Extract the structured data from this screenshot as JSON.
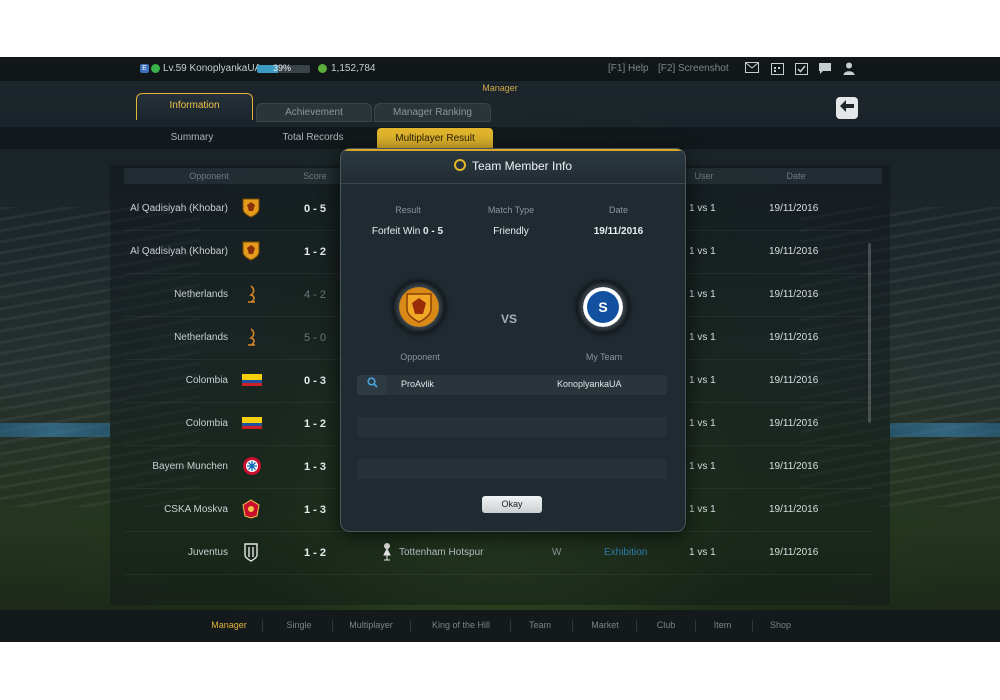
{
  "topbar": {
    "level": "Lv.59",
    "username": "KonoplyankaUA",
    "xp_percent": "39%",
    "xp_fraction": 0.39,
    "coins": "1,152,784",
    "help": "[F1] Help",
    "screenshot": "[F2] Screenshot",
    "badge_letter": "E"
  },
  "section": "Manager",
  "tabs": [
    {
      "label": "Information"
    },
    {
      "label": "Achievement"
    },
    {
      "label": "Manager Ranking"
    }
  ],
  "subtabs": [
    {
      "label": "Summary"
    },
    {
      "label": "Total Records"
    },
    {
      "label": "Multiplayer Result"
    }
  ],
  "table": {
    "headers": {
      "opponent": "Opponent",
      "score": "Score",
      "user": "User",
      "date": "Date"
    },
    "rows": [
      {
        "opponent": "Al Qadisiyah (Khobar)",
        "score": "0 - 5",
        "user": "1 vs 1",
        "date": "19/11/2016"
      },
      {
        "opponent": "Al Qadisiyah (Khobar)",
        "score": "1 - 2",
        "user": "1 vs 1",
        "date": "19/11/2016"
      },
      {
        "opponent": "Netherlands",
        "score": "4 - 2",
        "user": "1 vs 1",
        "date": "19/11/2016"
      },
      {
        "opponent": "Netherlands",
        "score": "5 - 0",
        "user": "1 vs 1",
        "date": "19/11/2016"
      },
      {
        "opponent": "Colombia",
        "score": "0 - 3",
        "user": "1 vs 1",
        "date": "19/11/2016"
      },
      {
        "opponent": "Colombia",
        "score": "1 - 2",
        "user": "1 vs 1",
        "date": "19/11/2016"
      },
      {
        "opponent": "Bayern Munchen",
        "score": "1 - 3",
        "user": "1 vs 1",
        "date": "19/11/2016"
      },
      {
        "opponent": "CSKA Moskva",
        "score": "1 - 3",
        "user": "1 vs 1",
        "date": "19/11/2016"
      },
      {
        "opponent": "Juventus",
        "score": "1 - 2",
        "user": "1 vs 1",
        "date": "19/11/2016",
        "team": "Tottenham Hotspur",
        "result": "W",
        "type": "Exhibition"
      }
    ]
  },
  "bottom_nav": [
    "Manager",
    "Single",
    "Multiplayer",
    "King of the Hill",
    "Team",
    "Market",
    "Club",
    "Item",
    "Shop"
  ],
  "modal": {
    "title": "Team Member Info",
    "labels": {
      "result": "Result",
      "match_type": "Match Type",
      "date": "Date",
      "opponent": "Opponent",
      "my_team": "My Team"
    },
    "result_prefix": "Forfeit Win",
    "result_score": "0 - 5",
    "match_type": "Friendly",
    "date": "19/11/2016",
    "vs": "VS",
    "opponent_user": "ProAvlik",
    "my_user": "KonoplyankaUA",
    "okay": "Okay",
    "colors": {
      "accent": "#e2b52c",
      "link_blue": "#49a3da"
    }
  }
}
